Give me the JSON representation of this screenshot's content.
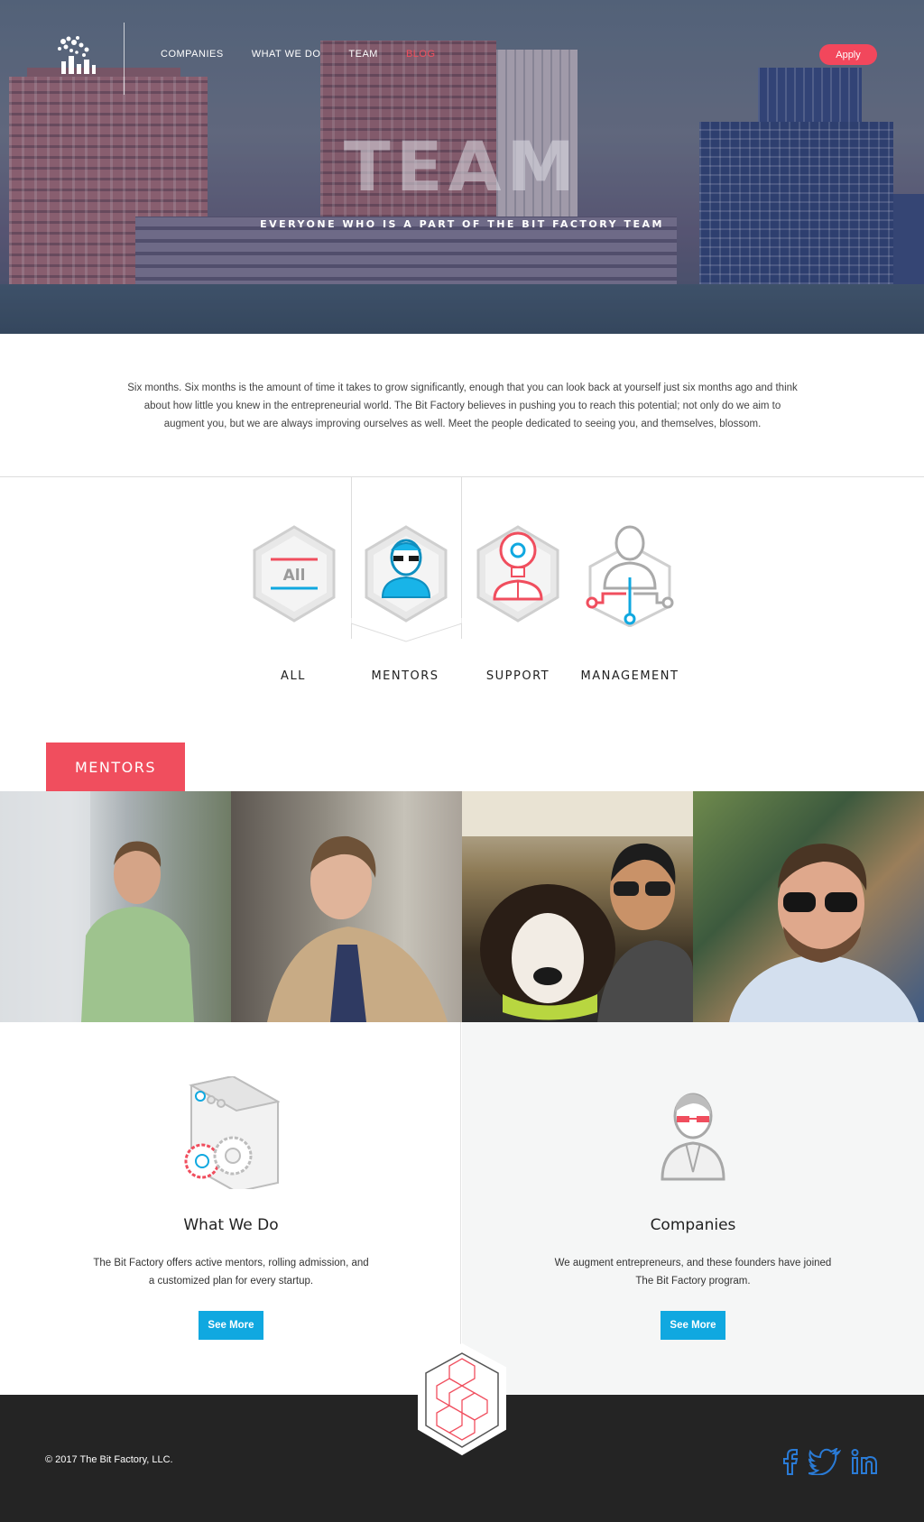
{
  "nav": {
    "links": [
      "COMPANIES",
      "WHAT WE DO",
      "TEAM",
      "BLOG"
    ],
    "apply_label": "Apply"
  },
  "hero": {
    "title": "TEAM",
    "subtitle": "EVERYONE WHO IS A PART OF THE BIT FACTORY TEAM"
  },
  "intro": {
    "text": "Six months. Six months is the amount of time it takes to grow significantly, enough that you can look back at yourself just six months ago and think about how little you knew in the entrepreneurial world. The Bit Factory believes in pushing you to reach this potential; not only do we aim to augment you, but we are always improving ourselves as well. Meet the people dedicated to seeing you, and themselves, blossom."
  },
  "filters": {
    "items": [
      {
        "label": "ALL",
        "icon_text": "All",
        "icon": "all-icon"
      },
      {
        "label": "MENTORS",
        "icon": "mentor-icon"
      },
      {
        "label": "SUPPORT",
        "icon": "lightbulb-person-icon"
      },
      {
        "label": "MANAGEMENT",
        "icon": "management-icon"
      }
    ],
    "selected": "MENTORS"
  },
  "mentors": {
    "section_label": "MENTORS"
  },
  "cards": [
    {
      "title": "What We Do",
      "text": "The Bit Factory offers active mentors, rolling admission, and a customized plan for every startup.",
      "button": "See More",
      "icon": "browser-gears-icon"
    },
    {
      "title": "Companies",
      "text": "We augment entrepreneurs, and these founders have joined The Bit Factory program.",
      "button": "See More",
      "icon": "founder-icon"
    }
  ],
  "footer": {
    "copyright": "© 2017 The Bit Factory, LLC.",
    "social": [
      "facebook-icon",
      "twitter-icon",
      "linkedin-icon"
    ]
  },
  "colors": {
    "accent_red": "#f04e5e",
    "accent_blue": "#10a8e0",
    "footer_bg": "#242424",
    "social_blue": "#2a7bd6"
  }
}
